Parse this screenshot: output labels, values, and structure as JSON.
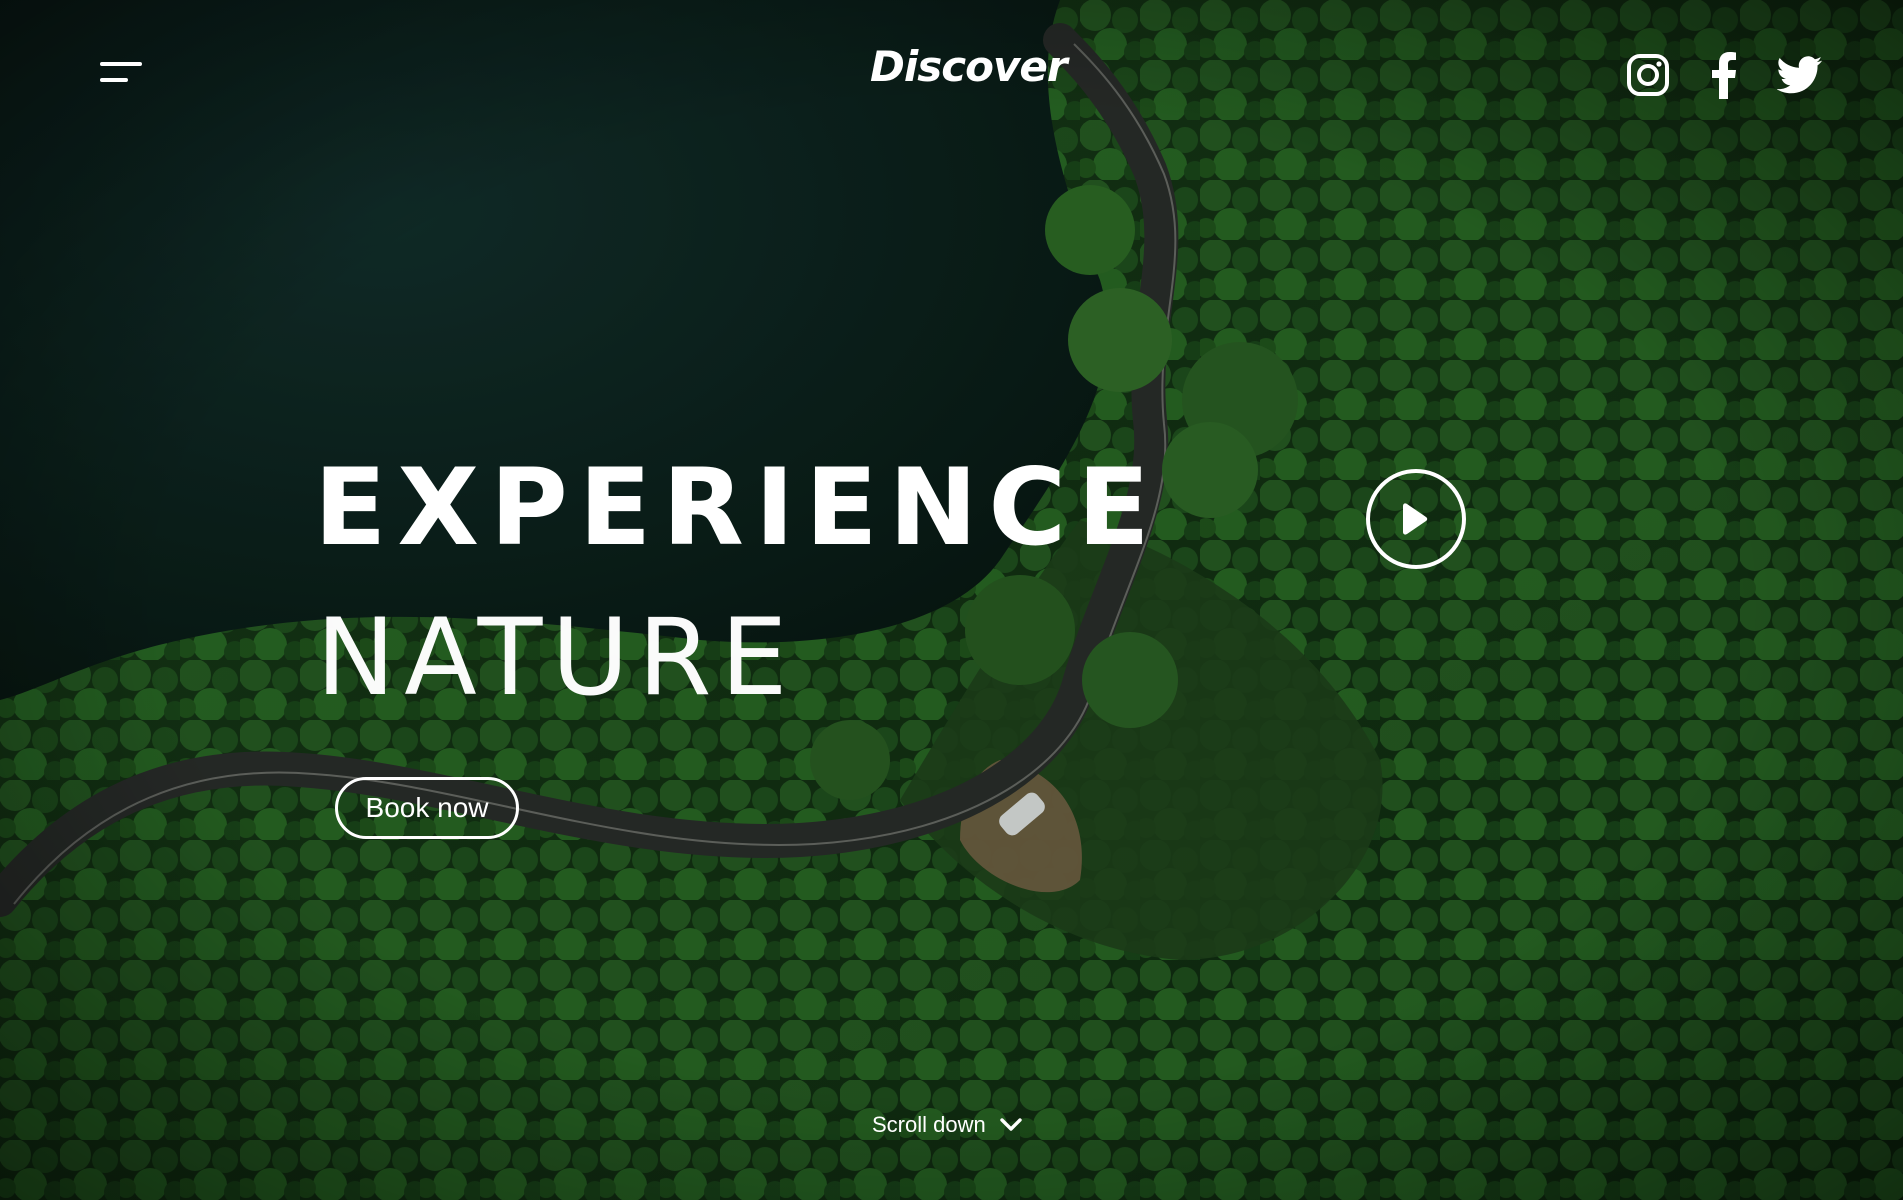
{
  "header": {
    "logo_text": "Discover",
    "socials": [
      {
        "icon": "instagram-icon"
      },
      {
        "icon": "facebook-icon"
      },
      {
        "icon": "twitter-icon"
      }
    ]
  },
  "hero": {
    "headline_line1": "EXPERIENCE",
    "headline_line2": "NATURE",
    "cta_label": "Book now",
    "play_icon": "play-icon",
    "scroll_label": "Scroll down",
    "scroll_icon": "chevron-down-icon"
  },
  "colors": {
    "text": "#ffffff",
    "forest": "#1f4a1f",
    "water": "#0e2a26",
    "road": "#2a2e2b"
  }
}
